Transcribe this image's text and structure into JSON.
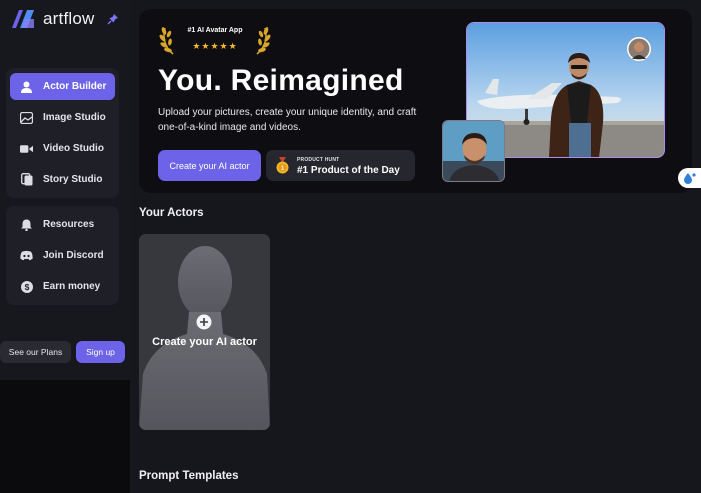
{
  "app": {
    "name": "artflow"
  },
  "sidebar": {
    "main_items": [
      {
        "label": "Actor Builder",
        "icon": "user-icon",
        "active": true
      },
      {
        "label": "Image Studio",
        "icon": "image-icon",
        "active": false
      },
      {
        "label": "Video Studio",
        "icon": "video-icon",
        "active": false
      },
      {
        "label": "Story Studio",
        "icon": "story-icon",
        "active": false
      }
    ],
    "secondary_items": [
      {
        "label": "Resources",
        "icon": "bell-icon"
      },
      {
        "label": "Join Discord",
        "icon": "discord-icon"
      },
      {
        "label": "Earn money",
        "icon": "dollar-icon"
      }
    ],
    "see_plans_label": "See our Plans",
    "sign_up_label": "Sign up"
  },
  "hero": {
    "award_badge": "#1 AI Avatar App",
    "stars": "★★★★★",
    "title": "You. Reimagined",
    "subtitle": "Upload your pictures, create your unique identity, and craft one-of-a-kind image and videos.",
    "cta_label": "Create your AI actor",
    "product_hunt": {
      "kicker": "PRODUCT HUNT",
      "label": "#1 Product of the Day"
    }
  },
  "actors_section": {
    "title": "Your Actors",
    "create_label": "Create your AI actor"
  },
  "templates_section": {
    "title": "Prompt Templates"
  },
  "colors": {
    "accent": "#6d63e8",
    "background": "#16161d",
    "gold": "#f3b529"
  }
}
